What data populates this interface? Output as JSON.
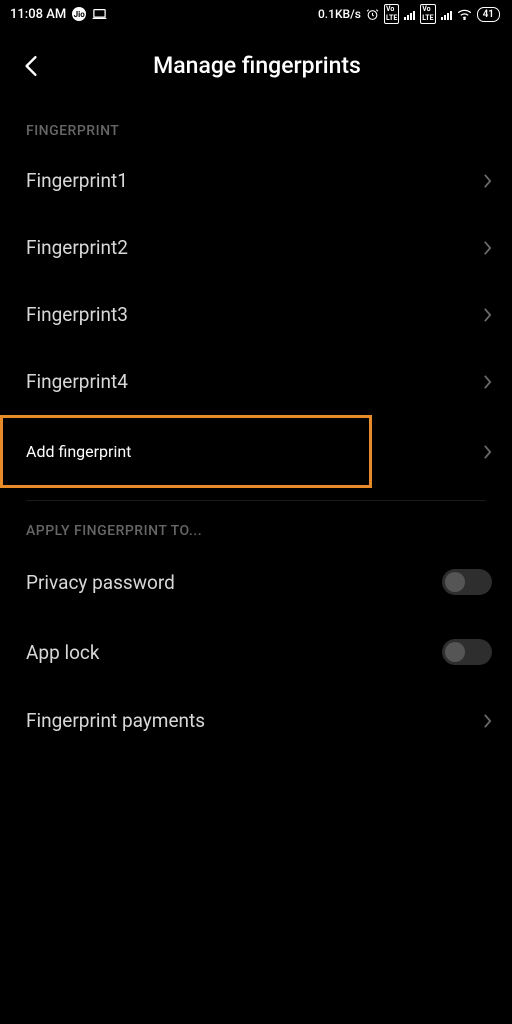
{
  "status": {
    "time": "11:08 AM",
    "dataSpeed": "0.1KB/s",
    "battery": "41"
  },
  "header": {
    "title": "Manage fingerprints"
  },
  "sections": {
    "fingerprint": {
      "header": "FINGERPRINT",
      "items": [
        "Fingerprint1",
        "Fingerprint2",
        "Fingerprint3",
        "Fingerprint4"
      ],
      "addLabel": "Add fingerprint"
    },
    "apply": {
      "header": "APPLY FINGERPRINT TO...",
      "privacyPassword": "Privacy password",
      "appLock": "App lock",
      "fingerprintPayments": "Fingerprint payments"
    }
  }
}
